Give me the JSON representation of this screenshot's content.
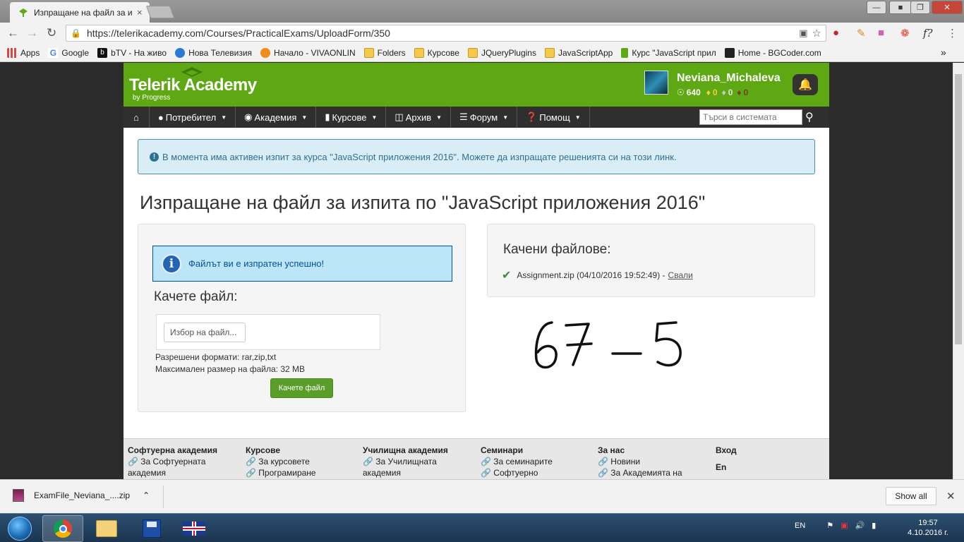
{
  "browser": {
    "tab_title": "Изпращане на файл за изпита",
    "tab_close": "×",
    "url": "https://telerikacademy.com/Courses/PracticalExams/UploadForm/350",
    "bookmarks": [
      {
        "label": "Apps"
      },
      {
        "label": "Google"
      },
      {
        "label": "bTV - На живо"
      },
      {
        "label": "Нова Телевизия"
      },
      {
        "label": "Начало - VIVAONLIN"
      },
      {
        "label": "Folders"
      },
      {
        "label": "Курсове"
      },
      {
        "label": "JQueryPlugins"
      },
      {
        "label": "JavaScriptApp"
      },
      {
        "label": "Курс \"JavaScript прил"
      },
      {
        "label": "Home - BGCoder.com"
      }
    ],
    "bookmarks_more": "»"
  },
  "header": {
    "logo_title": "Telerik Academy",
    "logo_sub": "by Progress",
    "username": "Neviana_Michaleva",
    "points": "640",
    "badge_gold": "0",
    "badge_silver": "0",
    "badge_bronze": "0"
  },
  "nav": {
    "items": [
      {
        "label": "Потребител"
      },
      {
        "label": "Академия"
      },
      {
        "label": "Курсове"
      },
      {
        "label": "Архив"
      },
      {
        "label": "Форум"
      },
      {
        "label": "Помощ"
      }
    ],
    "search_placeholder": "Търси в системата"
  },
  "alert_text": "В момента има активен изпит за курса \"JavaScript приложения 2016\". Можете да изпращате решенията си на този линк.",
  "page_title": "Изпращане на файл за изпита по \"JavaScript приложения 2016\"",
  "upload": {
    "success_msg": "Файлът ви е изпратен успешно!",
    "heading": "Качете файл:",
    "file_button": "Избор на файл...",
    "formats": "Разрешени формати: rar,zip,txt",
    "max_size": "Максимален размер на файла: 32 MB",
    "submit": "Качете файл"
  },
  "uploaded": {
    "heading": "Качени файлове:",
    "file": "Assignment.zip (04/10/2016 19:52:49) -",
    "download": "Свали"
  },
  "handwriting": "67 _ 5",
  "footer": {
    "columns": [
      {
        "title": "Софтуерна академия",
        "links": [
          "За Софтуерната",
          "академия"
        ]
      },
      {
        "title": "Курсове",
        "links": [
          "За курсовете",
          "Програмиране"
        ]
      },
      {
        "title": "Училищна академия",
        "links": [
          "За Училищната",
          "академия"
        ]
      },
      {
        "title": "Семинари",
        "links": [
          "За семинарите",
          "Софтуерно"
        ]
      },
      {
        "title": "За нас",
        "links": [
          "Новини",
          "За Академията на"
        ]
      },
      {
        "title": "Вход",
        "links": [
          "En"
        ]
      }
    ]
  },
  "downloads": {
    "file": "ExamFile_Neviana_....zip",
    "show_all": "Show all"
  },
  "taskbar": {
    "lang": "EN",
    "time": "19:57",
    "date": "4.10.2016 г."
  }
}
